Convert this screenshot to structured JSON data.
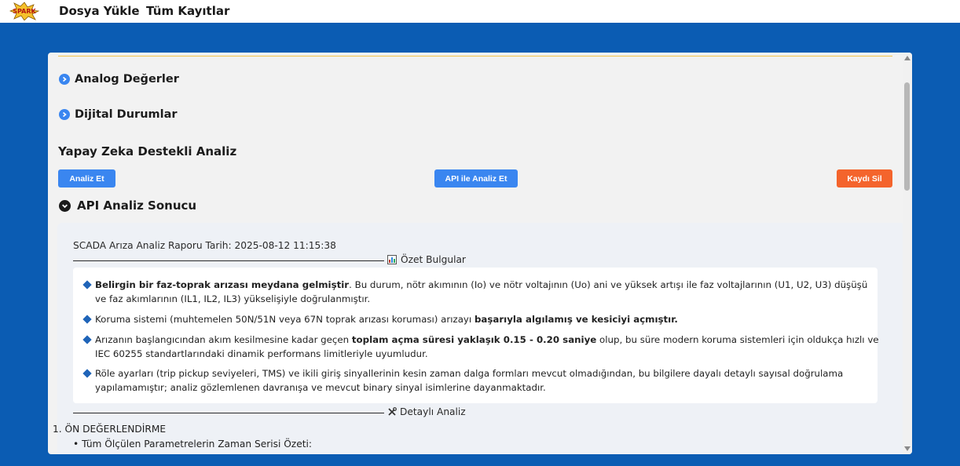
{
  "nav": {
    "logo_text": "SPARK",
    "upload": "Dosya Yükle",
    "records": "Tüm Kayıtlar"
  },
  "sections": {
    "analog": "Analog Değerler",
    "dijital": "Dijital Durumlar",
    "ai": "Yapay Zeka Destekli Analiz",
    "api_result": "API Analiz Sonucu"
  },
  "buttons": {
    "analiz": "Analiz Et",
    "api_analiz": "API ile Analiz Et",
    "sil": "Kaydı Sil"
  },
  "report": {
    "title": "SCADA Arıza Analiz Raporu Tarih: 2025-08-12 11:15:38",
    "summary_label": "Özet Bulgular",
    "detail_label": "Detaylı Analiz",
    "bullets": [
      {
        "bold": "Belirgin bir faz-toprak arızası meydana gelmiştir",
        "rest": ". Bu durum, nötr akımının (Io) ve nötr voltajının (Uo) ani ve yüksek artışı ile faz voltajlarının (U1, U2, U3) düşüşü ve faz akımlarının (IL1, IL2, IL3) yükselişiyle doğrulanmıştır."
      },
      {
        "pre": "Koruma sistemi (muhtemelen 50N/51N veya 67N toprak arızası koruması) arızayı ",
        "bold": "başarıyla algılamış ve kesiciyi açmıştır."
      },
      {
        "pre": "Arızanın başlangıcından akım kesilmesine kadar geçen ",
        "bold": "toplam açma süresi yaklaşık 0.15 - 0.20 saniye",
        "rest": " olup, bu süre modern koruma sistemleri için oldukça hızlı ve IEC 60255 standartlarındaki dinamik performans limitleriyle uyumludur."
      },
      {
        "rest": "Röle ayarları (trip pickup seviyeleri, TMS) ve ikili giriş sinyallerinin kesin zaman dalga formları mevcut olmadığından, bu bilgilere dayalı detaylı sayısal doğrulama yapılamamıştır; analiz gözlemlenen davranışa ve mevcut binary sinyal isimlerine dayanmaktadır."
      }
    ],
    "section1": "1. ÖN DEĞERLENDİRME",
    "section1_item": "• Tüm Ölçülen Parametrelerin Zaman Serisi Özeti:"
  },
  "colors": {
    "background": "#0b5cb3",
    "accent": "#3a86f0",
    "danger": "#f4642c"
  }
}
